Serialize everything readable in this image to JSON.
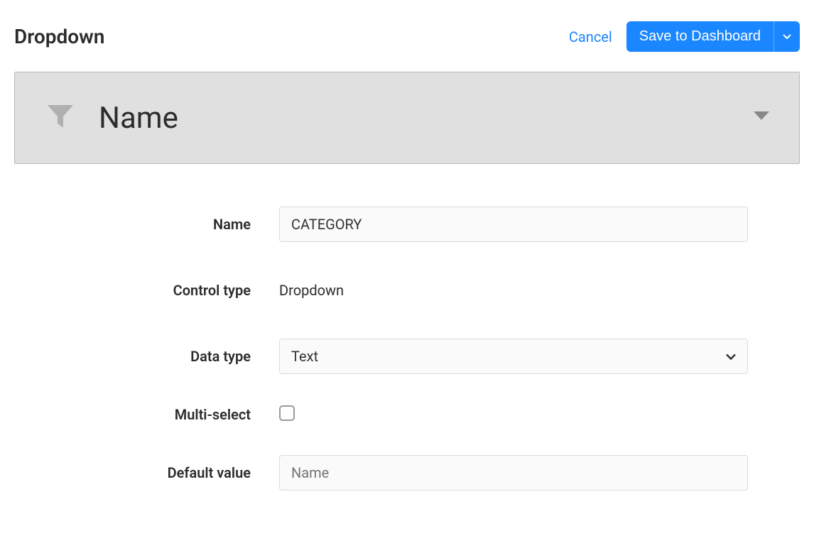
{
  "header": {
    "title": "Dropdown",
    "cancel_label": "Cancel",
    "save_label": "Save to Dashboard"
  },
  "preview": {
    "title": "Name"
  },
  "form": {
    "name": {
      "label": "Name",
      "value": "CATEGORY"
    },
    "control_type": {
      "label": "Control type",
      "value": "Dropdown"
    },
    "data_type": {
      "label": "Data type",
      "value": "Text"
    },
    "multi_select": {
      "label": "Multi-select",
      "checked": false
    },
    "default_value": {
      "label": "Default value",
      "value": "",
      "placeholder": "Name"
    }
  }
}
